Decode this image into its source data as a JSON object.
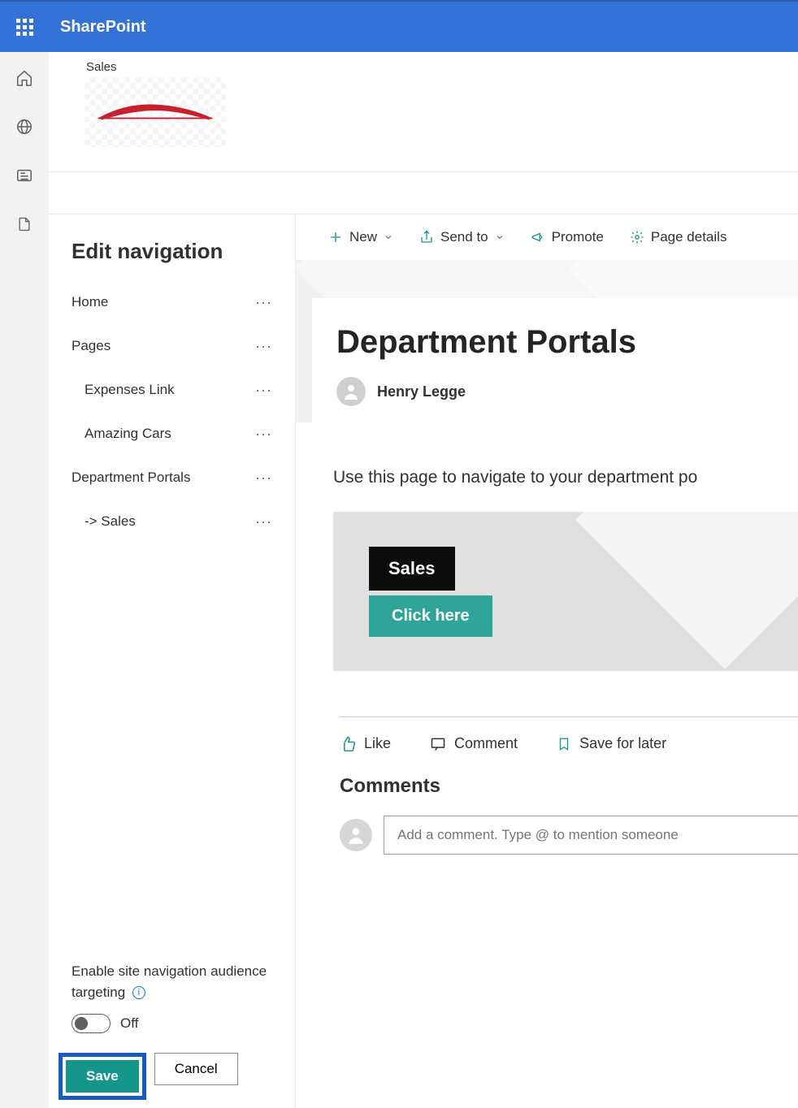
{
  "top_bar": {
    "app_name": "SharePoint"
  },
  "site_header": {
    "site_label": "Sales"
  },
  "nav_panel": {
    "title": "Edit navigation",
    "items": [
      {
        "label": "Home",
        "indent": false
      },
      {
        "label": "Pages",
        "indent": false
      },
      {
        "label": "Expenses Link",
        "indent": true
      },
      {
        "label": "Amazing Cars",
        "indent": true
      },
      {
        "label": "Department Portals",
        "indent": false
      },
      {
        "label": "-> Sales",
        "indent": true
      }
    ],
    "targeting_label": "Enable site navigation audience targeting",
    "toggle_state_label": "Off",
    "save_label": "Save",
    "cancel_label": "Cancel"
  },
  "cmd_bar": {
    "new_label": "New",
    "send_to_label": "Send to",
    "promote_label": "Promote",
    "page_details_label": "Page details"
  },
  "page": {
    "title": "Department Portals",
    "author": "Henry Legge",
    "description": "Use this page to navigate to your department po",
    "portal_badge": "Sales",
    "portal_button": "Click here"
  },
  "actions": {
    "like_label": "Like",
    "comment_label": "Comment",
    "save_later_label": "Save for later"
  },
  "comments": {
    "heading": "Comments",
    "placeholder": "Add a comment. Type @ to mention someone"
  }
}
